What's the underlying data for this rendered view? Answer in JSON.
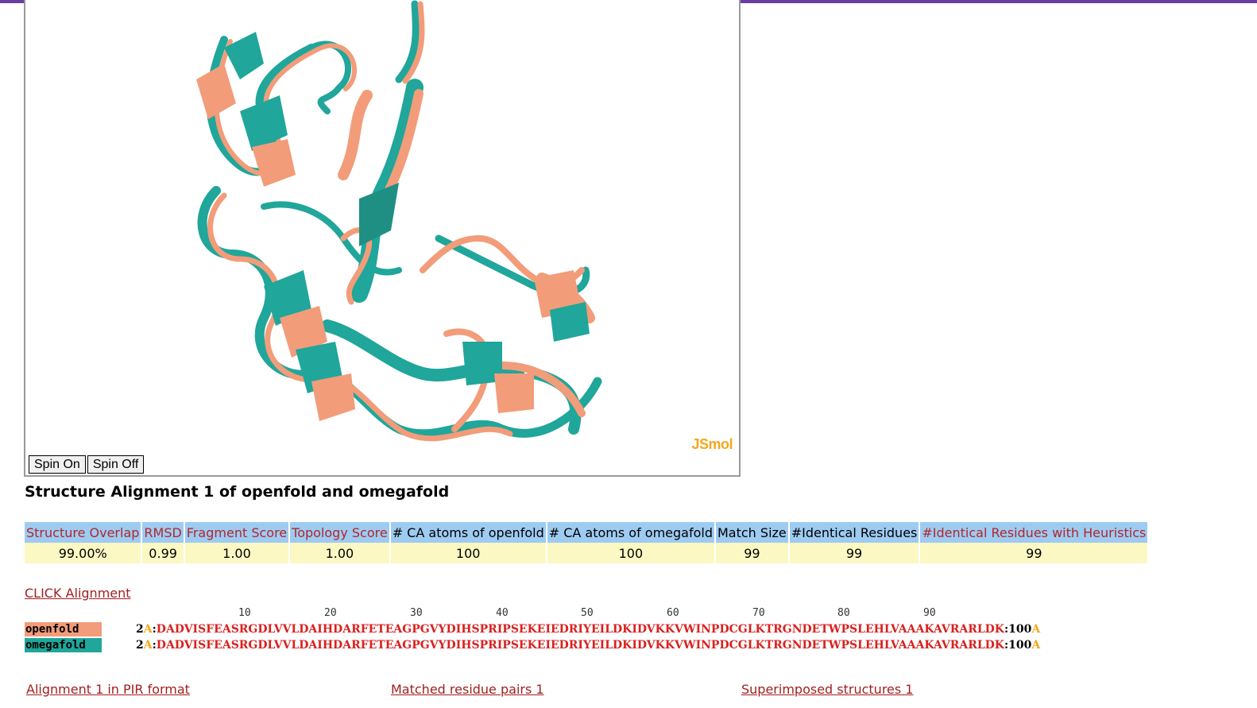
{
  "viewer": {
    "logo": "JSmol",
    "spin_on": "Spin On",
    "spin_off": "Spin Off",
    "colors": {
      "openfold": "#f29c7a",
      "omegafold": "#20a69a"
    }
  },
  "title": "Structure Alignment 1 of openfold and omegafold",
  "scores": {
    "headers": [
      "Structure Overlap",
      "RMSD",
      "Fragment Score",
      "Topology Score",
      "# CA atoms of openfold",
      "# CA atoms of omegafold",
      "Match Size",
      "#Identical Residues",
      "#Identical Residues with Heuristics"
    ],
    "values": [
      "99.00%",
      "0.99",
      "1.00",
      "1.00",
      "100",
      "100",
      "99",
      "99",
      "99"
    ]
  },
  "alignment_link": "CLICK Alignment",
  "ruler": [
    "10",
    "20",
    "30",
    "40",
    "50",
    "60",
    "70",
    "80",
    "90"
  ],
  "sequences": [
    {
      "label": "openfold",
      "start": "2",
      "chain": "A",
      "seq": "DADVISFEASRGDLVVLDAIHDARFETEAGPGVYDIHSPRIPSEKEIEDRIYEILDKIDVKKVWINPDCGLKTRGNDETWPSLEHLVAAAKAVRARLDK",
      "end": "100",
      "end_chain": "A"
    },
    {
      "label": "omegafold",
      "start": "2",
      "chain": "A",
      "seq": "DADVISFEASRGDLVVLDAIHDARFETEAGPGVYDIHSPRIPSEKEIEDRIYEILDKIDVKKVWINPDCGLKTRGNDETWPSLEHLVAAAKAVRARLDK",
      "end": "100",
      "end_chain": "A"
    }
  ],
  "links": {
    "pir": "Alignment 1 in PIR format",
    "pairs": "Matched residue pairs 1",
    "superimposed": "Superimposed structures 1"
  }
}
